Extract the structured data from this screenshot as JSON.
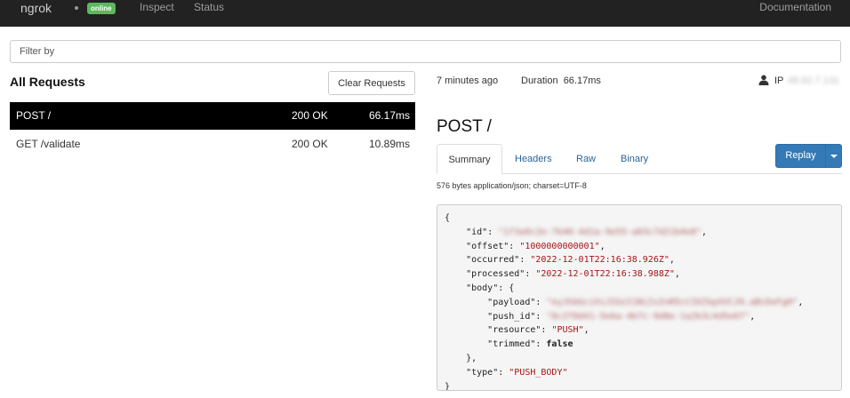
{
  "navbar": {
    "brand": "ngrok",
    "status_badge": "online",
    "links": [
      "Inspect",
      "Status"
    ],
    "docs": "Documentation"
  },
  "filter": {
    "placeholder": "Filter by"
  },
  "requests": {
    "title": "All Requests",
    "clear_label": "Clear Requests",
    "rows": [
      {
        "path": "POST /",
        "status": "200 OK",
        "duration": "66.17ms"
      },
      {
        "path": "GET /validate",
        "status": "200 OK",
        "duration": "10.89ms"
      }
    ]
  },
  "detail": {
    "time_ago": "7 minutes ago",
    "duration": "Duration  66.17ms",
    "ip_label": "IP",
    "ip_value": "48.92.7.131",
    "title": "POST /",
    "tabs": [
      "Summary",
      "Headers",
      "Raw",
      "Binary"
    ],
    "replay_label": "Replay",
    "body_info": "576 bytes application/json; charset=UTF-8"
  },
  "json_body": {
    "open": "{",
    "id_key": "\"id\"",
    "id_val": "\"1f3a9c2e-7b40-4d1a-9e55-a03c7d21b4e8\"",
    "offset_key": "\"offset\"",
    "offset_val": "\"1000000000001\"",
    "occurred_key": "\"occurred\"",
    "occurred_val": "\"2022-12-01T22:16:38.926Z\"",
    "processed_key": "\"processed\"",
    "processed_val": "\"2022-12-01T22:16:38.988Z\"",
    "body_key": "\"body\"",
    "body_open": ": {",
    "payload_key": "\"payload\"",
    "payload_val": "\"eyJhbGciOiJIUzI1NiIsInR5cCI6IkpXVCJ9.aBcDeFgH\"",
    "push_id_key": "\"push_id\"",
    "push_id_val": "\"8c2f0d41-5e6a-4b7c-9d8e-1a2b3c4d5e6f\"",
    "resource_key": "\"resource\"",
    "resource_val": "\"PUSH\"",
    "trimmed_key": "\"trimmed\"",
    "trimmed_val": "false",
    "body_close": "},",
    "type_key": "\"type\"",
    "type_val": "\"PUSH_BODY\"",
    "close": "}"
  },
  "colors": {
    "navbar_bg": "#222222",
    "online_badge": "#5cb85c",
    "replay_button": "#337ab7",
    "selected_row": "#000000",
    "json_string": "#a31515"
  }
}
